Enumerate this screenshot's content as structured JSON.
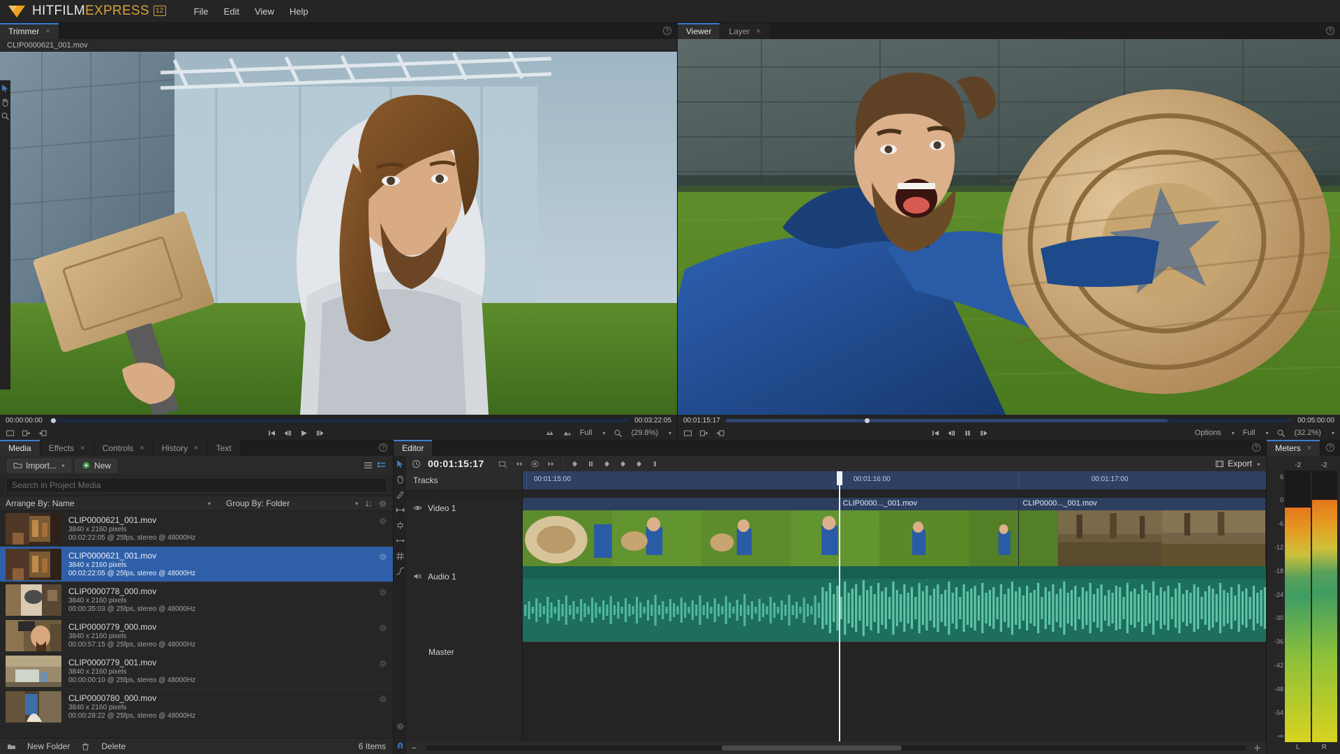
{
  "app": {
    "brand_first": "HITFILM",
    "brand_second": "EXPRESS",
    "version_badge": "12",
    "menu": [
      {
        "label": "File"
      },
      {
        "label": "Edit"
      },
      {
        "label": "View"
      },
      {
        "label": "Help"
      }
    ]
  },
  "trimmer": {
    "tab_label": "Trimmer",
    "close_glyph": "×",
    "clip_name": "CLIP0000621_001.mov",
    "help_glyph": "?",
    "timecode_current": "00:00:00:00",
    "timecode_total": "00:03:22:05",
    "quality_label": "Full",
    "zoom_label": "(29.8%)",
    "caret": "▾"
  },
  "viewer": {
    "tabs": [
      {
        "label": "Viewer",
        "active": true,
        "closable": false
      },
      {
        "label": "Layer",
        "active": false,
        "closable": true
      }
    ],
    "close_glyph": "×",
    "help_glyph": "?",
    "timecode_current": "00:01:15:17",
    "timecode_total": "00:05:00:00",
    "options_label": "Options",
    "quality_label": "Full",
    "zoom_label": "(32.2%)",
    "caret": "▾"
  },
  "media": {
    "tabs": [
      {
        "label": "Media",
        "active": true,
        "closable": false
      },
      {
        "label": "Effects",
        "active": false,
        "closable": true
      },
      {
        "label": "Controls",
        "active": false,
        "closable": true
      },
      {
        "label": "History",
        "active": false,
        "closable": true
      },
      {
        "label": "Text",
        "active": false,
        "closable": false
      }
    ],
    "help_glyph": "?",
    "import_label": "Import...",
    "import_caret": "▸",
    "new_label": "New",
    "search_placeholder": "Search in Project Media",
    "arrange_label": "Arrange By: Name",
    "group_label": "Group By: Folder",
    "arrange_caret": "▾",
    "items": [
      {
        "name": "CLIP0000621_001.mov",
        "resolution": "3840 x 2160 pixels",
        "details": "00:02:22:05 @ 25fps, stereo @ 48000Hz",
        "selected": false
      },
      {
        "name": "CLIP0000621_001.mov",
        "resolution": "3840 x 2160 pixels",
        "details": "00:02:22:05 @ 25fps, stereo @ 48000Hz",
        "selected": true
      },
      {
        "name": "CLIP0000778_000.mov",
        "resolution": "3840 x 2160 pixels",
        "details": "00:00:35:03 @ 25fps, stereo @ 48000Hz",
        "selected": false
      },
      {
        "name": "CLIP0000779_000.mov",
        "resolution": "3840 x 2160 pixels",
        "details": "00:00:57:15 @ 25fps, stereo @ 48000Hz",
        "selected": false
      },
      {
        "name": "CLIP0000779_001.mov",
        "resolution": "3840 x 2160 pixels",
        "details": "00:00:00:10 @ 25fps, stereo @ 48000Hz",
        "selected": false
      },
      {
        "name": "CLIP0000780_000.mov",
        "resolution": "3840 x 2160 pixels",
        "details": "00:00:28:22 @ 25fps, stereo @ 48000Hz",
        "selected": false
      }
    ],
    "new_folder_label": "New Folder",
    "delete_label": "Delete",
    "item_count": "6 Items"
  },
  "editor": {
    "tab_label": "Editor",
    "help_glyph": "?",
    "playhead_timecode": "00:01:15:17",
    "export_label": "Export",
    "export_caret": "▸",
    "tracks_label": "Tracks",
    "ruler_ticks": [
      {
        "label": "00:01:15:00",
        "left_pct": 0.5
      },
      {
        "label": "00:01:16:00",
        "left_pct": 50.5
      },
      {
        "label": "00:01:17:00",
        "left_pct": 82.5
      }
    ],
    "tracks": [
      {
        "name": "Video 1",
        "type": "video"
      },
      {
        "name": "Audio 1",
        "type": "audio"
      },
      {
        "name": "Master",
        "type": "master"
      }
    ],
    "clips": [
      {
        "label": "CLIP0000..._001.mov",
        "left_pct": 42.5,
        "width_pct": 24.2
      },
      {
        "label": "CLIP0000..._001.mov",
        "left_pct": 66.7,
        "width_pct": 33.3
      }
    ]
  },
  "meters": {
    "tab_label": "Meters",
    "close_glyph": "×",
    "help_glyph": "?",
    "peak_left": "-2",
    "peak_right": "-2",
    "scale_labels": [
      "6",
      "0",
      "-6",
      "-12",
      "-18",
      "-24",
      "-30",
      "-36",
      "-42",
      "-48",
      "-54",
      "-∞"
    ],
    "channel_left": "L",
    "channel_right": "R",
    "level_left_db": -1.6,
    "level_right_db": -1.0
  },
  "colors": {
    "accent_blue": "#3a7fd5",
    "brand_gold": "#d8a13a",
    "selection_blue": "#2f5fa8",
    "timeline_blue": "#2e4063",
    "audio_green": "#1d6e5c"
  }
}
